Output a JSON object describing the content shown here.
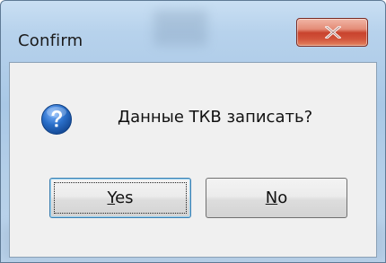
{
  "window": {
    "title": "Confirm",
    "close_icon": "close-x-icon"
  },
  "dialog": {
    "icon": "question-icon",
    "message": "Данные ТКВ записать?"
  },
  "buttons": {
    "yes": {
      "accel": "Y",
      "rest": "es"
    },
    "no": {
      "accel": "N",
      "rest": "o"
    }
  },
  "colors": {
    "close_button": "#c8432d",
    "icon_blue": "#2a6fc9",
    "focus_border": "#3c7fb1"
  }
}
